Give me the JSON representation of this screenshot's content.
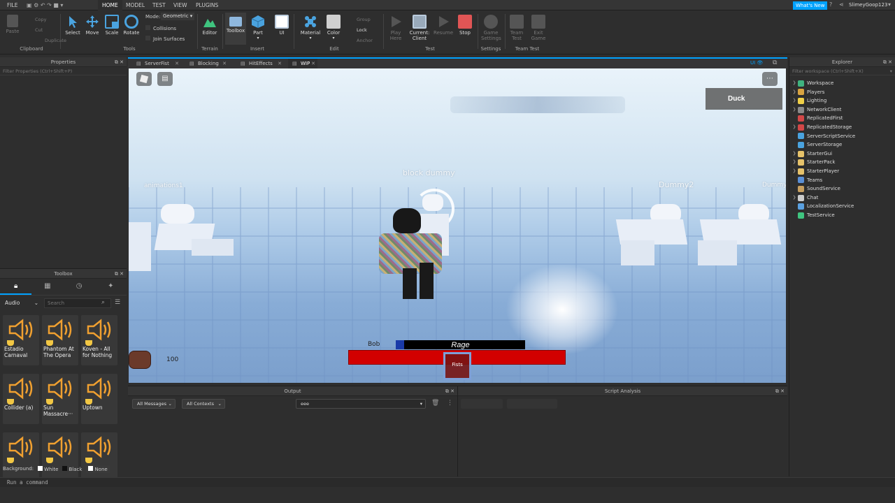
{
  "menu": {
    "file": "FILE",
    "tabs": [
      "HOME",
      "MODEL",
      "TEST",
      "VIEW",
      "PLUGINS"
    ],
    "whats_new": "What's New",
    "username": "SlimeyGoop123"
  },
  "ribbon": {
    "clipboard": {
      "paste": "Paste",
      "copy": "Copy",
      "cut": "Cut",
      "duplicate": "Duplicate",
      "group": "Clipboard"
    },
    "tools": {
      "select": "Select",
      "move": "Move",
      "scale": "Scale",
      "rotate": "Rotate",
      "mode_label": "Mode:",
      "mode_value": "Geometric",
      "collisions": "Collisions",
      "join_surfaces": "Join Surfaces",
      "group": "Tools"
    },
    "terrain": {
      "editor": "Editor",
      "group": "Terrain"
    },
    "insert": {
      "toolbox": "Toolbox",
      "part": "Part",
      "ui": "UI",
      "group": "Insert"
    },
    "edit": {
      "material": "Material",
      "color": "Color",
      "group_btn": "Group",
      "lock": "Lock",
      "anchor": "Anchor",
      "group": "Edit"
    },
    "test": {
      "play": "Play",
      "play_sub": "Here",
      "current": "Current:",
      "client": "Client",
      "resume": "Resume",
      "stop": "Stop",
      "group": "Test"
    },
    "settings": {
      "game": "Game",
      "game_sub": "Settings",
      "group": "Settings"
    },
    "team_test": {
      "team": "Team",
      "team_sub": "Test",
      "exit": "Exit",
      "exit_sub": "Game",
      "group": "Team Test"
    }
  },
  "properties": {
    "title": "Properties",
    "filter": "Filter Properties (Ctrl+Shift+P)"
  },
  "toolbox": {
    "title": "Toolbox",
    "category": "Audio",
    "search_placeholder": "Search",
    "assets": [
      {
        "name": "Estadio Carnaval"
      },
      {
        "name": "Phantom At The Opera"
      },
      {
        "name": "Koven - All for Nothing"
      },
      {
        "name": "Collider (a)"
      },
      {
        "name": "Sun Massacre···"
      },
      {
        "name": "Uptown"
      },
      {
        "name": ""
      },
      {
        "name": ""
      },
      {
        "name": ""
      }
    ],
    "background_label": "Background:",
    "bg_white": "White",
    "bg_black": "Black",
    "bg_none": "None"
  },
  "doc_tabs": [
    "ServerFist",
    "Blocking",
    "HitEffects",
    "WIP"
  ],
  "viewport": {
    "ui_label": "UI",
    "duck": "Duck",
    "block_dummy": "block dummy",
    "animations": "animations1",
    "dummy2": "Dummy2",
    "dummy_right": "Dummy",
    "bob": "Bob",
    "rage": "Rage",
    "fists": "Fists",
    "hp": "100"
  },
  "output": {
    "title": "Output",
    "all_messages": "All Messages",
    "all_contexts": "All Contexts",
    "filter_value": "eee"
  },
  "script_analysis": {
    "title": "Script Analysis"
  },
  "explorer": {
    "title": "Explorer",
    "filter": "Filter workspace (Ctrl+Shift+X)",
    "items": [
      {
        "name": "Workspace",
        "color": "#3fb37f",
        "caret": true
      },
      {
        "name": "Players",
        "color": "#d9a441",
        "caret": true
      },
      {
        "name": "Lighting",
        "color": "#f0d048",
        "caret": true
      },
      {
        "name": "NetworkClient",
        "color": "#8a8a8a",
        "caret": true
      },
      {
        "name": "ReplicatedFirst",
        "color": "#d24747",
        "caret": false
      },
      {
        "name": "ReplicatedStorage",
        "color": "#d24747",
        "caret": true
      },
      {
        "name": "ServerScriptService",
        "color": "#4aa3df",
        "caret": false
      },
      {
        "name": "ServerStorage",
        "color": "#4aa3df",
        "caret": false
      },
      {
        "name": "StarterGui",
        "color": "#e6c26a",
        "caret": true
      },
      {
        "name": "StarterPack",
        "color": "#e6c26a",
        "caret": true
      },
      {
        "name": "StarterPlayer",
        "color": "#e6c26a",
        "caret": true
      },
      {
        "name": "Teams",
        "color": "#5a8fd6",
        "caret": false
      },
      {
        "name": "SoundService",
        "color": "#c8a060",
        "caret": false
      },
      {
        "name": "Chat",
        "color": "#cccccc",
        "caret": true
      },
      {
        "name": "LocalizationService",
        "color": "#5aa0e0",
        "caret": false
      },
      {
        "name": "TestService",
        "color": "#3fc47f",
        "caret": false
      }
    ]
  },
  "command_bar": {
    "placeholder": "Run a command"
  },
  "colors": {
    "accent": "#00a2ff",
    "rage_red": "#d20000",
    "stop_red": "#e05555"
  }
}
